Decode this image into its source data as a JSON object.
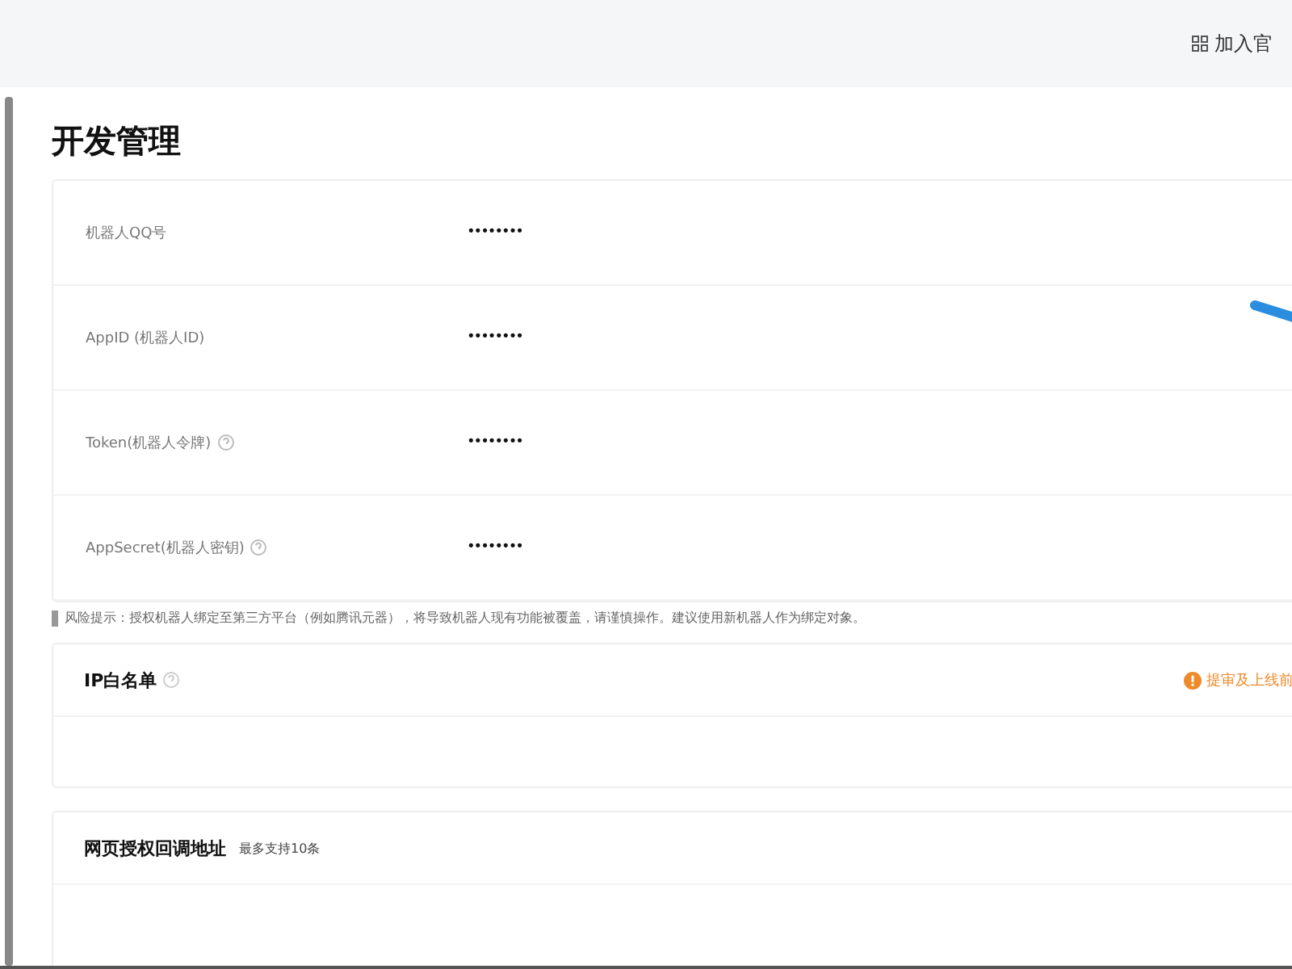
{
  "top_bar": {
    "link": "加入官"
  },
  "page": {
    "title": "开发管理"
  },
  "credentials": [
    {
      "label": "机器人QQ号",
      "help": false,
      "value": "••••••••"
    },
    {
      "label": "AppID (机器人ID)",
      "help": false,
      "value": "••••••••"
    },
    {
      "label": "Token(机器人令牌)",
      "help": true,
      "value": "••••••••"
    },
    {
      "label": "AppSecret(机器人密钥)",
      "help": true,
      "value": "••••••••"
    }
  ],
  "risk_notice": "风险提示：授权机器人绑定至第三方平台（例如腾讯元器），将导致机器人现有功能被覆盖，请谨慎操作。建议使用新机器人作为绑定对象。",
  "ip_whitelist": {
    "title": "IP白名单",
    "help": true,
    "warning": "提审及上线前"
  },
  "callback": {
    "title": "网页授权回调地址",
    "note": "最多支持10条"
  }
}
